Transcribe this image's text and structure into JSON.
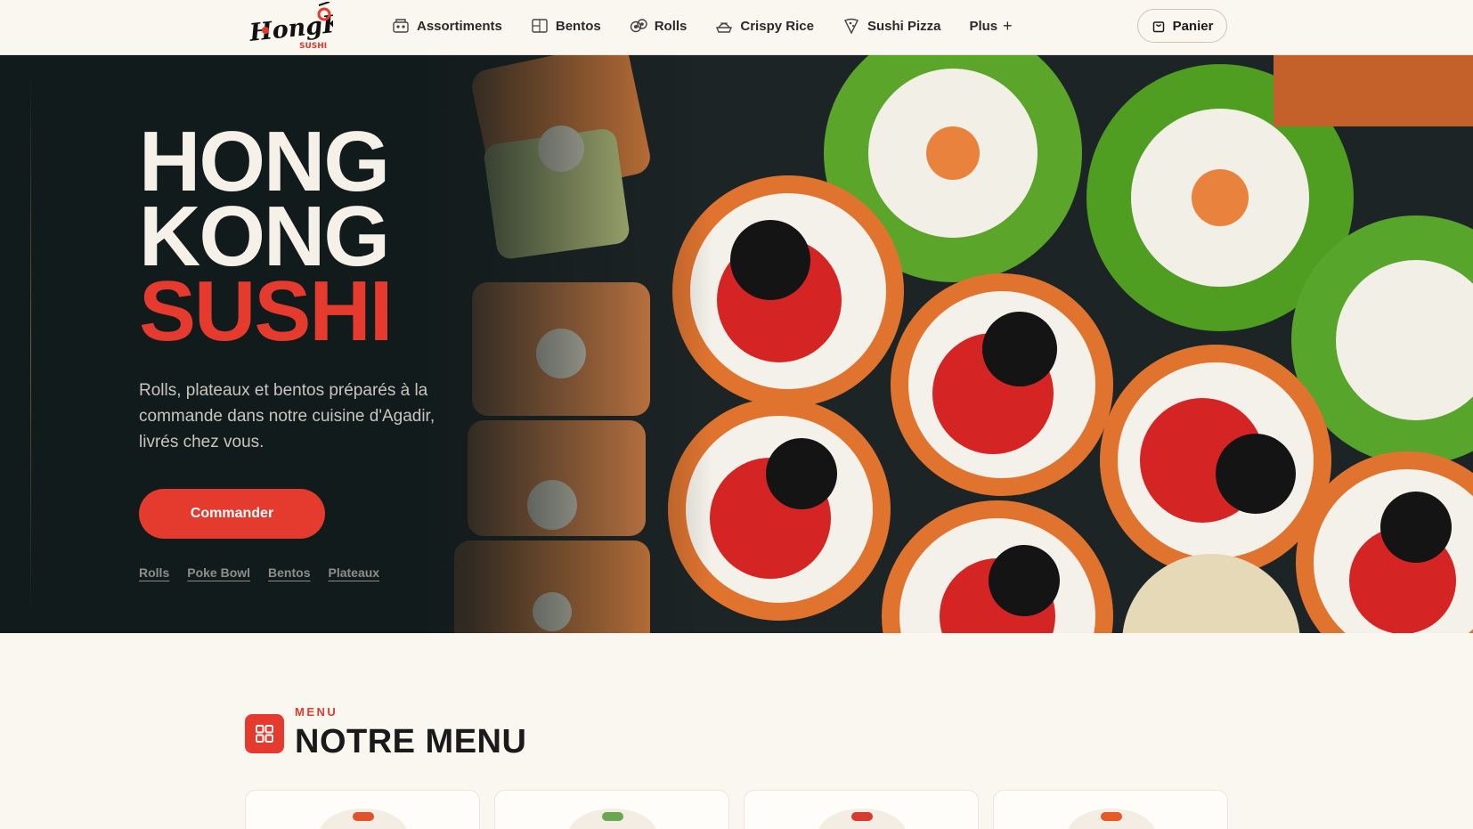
{
  "brand": {
    "logo_text": "HongKong",
    "logo_sub": "SUSHI",
    "red": "#e53a2e",
    "dark": "#121b1c",
    "cream": "#faf6f0"
  },
  "nav": {
    "items": [
      {
        "label": "Assortiments",
        "icon": "assortment-box-icon"
      },
      {
        "label": "Bentos",
        "icon": "bento-box-icon"
      },
      {
        "label": "Rolls",
        "icon": "sushi-roll-icon"
      },
      {
        "label": "Crispy Rice",
        "icon": "crispy-rice-icon"
      },
      {
        "label": "Sushi Pizza",
        "icon": "pizza-slice-icon"
      }
    ],
    "more_label": "Plus",
    "cart_label": "Panier"
  },
  "hero": {
    "title_line1": "HONG",
    "title_line2": "KONG",
    "title_line3": "SUSHI",
    "description": "Rolls, plateaux et bentos préparés à la commande dans notre cuisine d'Agadir, livrés chez vous.",
    "cta_label": "Commander",
    "quick_links": [
      "Rolls",
      "Poke Bowl",
      "Bentos",
      "Plateaux"
    ]
  },
  "menu_section": {
    "kicker": "MENU",
    "title": "NOTRE MENU",
    "card_accents": [
      "#e0532d",
      "#6aa84f",
      "#d63a30",
      "#e55a28"
    ]
  }
}
